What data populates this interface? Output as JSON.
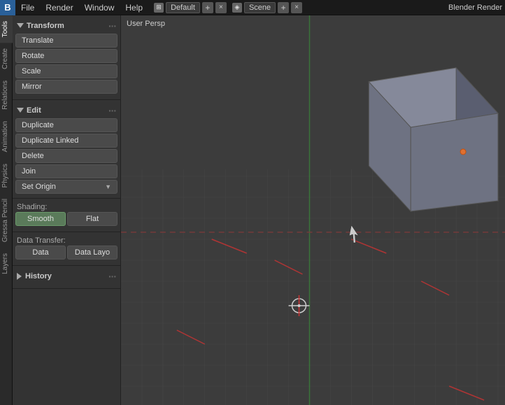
{
  "topbar": {
    "icon": "B",
    "menus": [
      "File",
      "Render",
      "Window",
      "Help"
    ],
    "workspace": "Default",
    "scene": "Scene",
    "engine": "Blender Render",
    "plus_label": "+",
    "x_label": "×"
  },
  "vertical_tabs": [
    {
      "label": "Tools",
      "active": true
    },
    {
      "label": "Create",
      "active": false
    },
    {
      "label": "Relations",
      "active": false
    },
    {
      "label": "Animation",
      "active": false
    },
    {
      "label": "Physics",
      "active": false
    },
    {
      "label": "Gressa Pencil",
      "active": false
    },
    {
      "label": "Layers",
      "active": false
    }
  ],
  "tools_panel": {
    "transform_header": "Transform",
    "transform_dots": "···",
    "translate_label": "Translate",
    "rotate_label": "Rotate",
    "scale_label": "Scale",
    "mirror_label": "Mirror",
    "edit_header": "Edit",
    "edit_dots": "···",
    "duplicate_label": "Duplicate",
    "duplicate_linked_label": "Duplicate Linked",
    "delete_label": "Delete",
    "join_label": "Join",
    "set_origin_label": "Set Origin",
    "shading_label": "Shading:",
    "smooth_label": "Smooth",
    "flat_label": "Flat",
    "data_transfer_label": "Data Transfer:",
    "data_label": "Data",
    "data_layers_label": "Data Layo",
    "history_header": "History",
    "history_dots": "···"
  },
  "viewport": {
    "label": "User Persp"
  },
  "colors": {
    "background": "#3c3c3c",
    "panel": "#333333",
    "button": "#4a4a4a",
    "active_btn": "#5a7a5a",
    "grid_main": "#4a4a4a",
    "grid_x": "#6a2020",
    "grid_y": "#204a20",
    "cube_top": "#7a7e8a",
    "cube_right": "#5a5e6a",
    "cube_left": "#6a6e7a"
  }
}
